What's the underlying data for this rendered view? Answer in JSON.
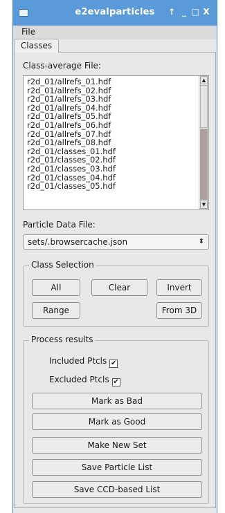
{
  "window": {
    "title": "e2evalparticles",
    "buttons": {
      "pin": "↑",
      "minimize": "_",
      "maximize": "□",
      "close": "X"
    }
  },
  "menubar": {
    "file": "File"
  },
  "tabs": [
    {
      "label": "Classes",
      "selected": true
    }
  ],
  "class_average": {
    "label": "Class-average File:",
    "items": [
      "r2d_01/allrefs_01.hdf",
      "r2d_01/allrefs_02.hdf",
      "r2d_01/allrefs_03.hdf",
      "r2d_01/allrefs_04.hdf",
      "r2d_01/allrefs_05.hdf",
      "r2d_01/allrefs_06.hdf",
      "r2d_01/allrefs_07.hdf",
      "r2d_01/allrefs_08.hdf",
      "r2d_01/classes_01.hdf",
      "r2d_01/classes_02.hdf",
      "r2d_01/classes_03.hdf",
      "r2d_01/classes_04.hdf",
      "r2d_01/classes_05.hdf"
    ],
    "scroll_up": "▲",
    "scroll_down": "▼"
  },
  "particle_data": {
    "label": "Particle Data File:",
    "value": "sets/.browsercache.json",
    "arrow": "⬍"
  },
  "class_selection": {
    "title": "Class Selection",
    "all": "All",
    "clear": "Clear",
    "invert": "Invert",
    "range": "Range",
    "from3d": "From 3D"
  },
  "process": {
    "title": "Process results",
    "included": {
      "label": "Included Ptcls",
      "checked": true,
      "mark": "✔"
    },
    "excluded": {
      "label": "Excluded Ptcls",
      "checked": true,
      "mark": "✔"
    },
    "mark_bad": "Mark as Bad",
    "mark_good": "Mark as Good",
    "new_set": "Make New Set",
    "save_list": "Save Particle List",
    "save_ccd": "Save CCD-based List"
  },
  "colors": {
    "titlebar": "#5b9ad8",
    "window_bg": "#e8e8e8",
    "scroll_track": "#aca09e"
  }
}
